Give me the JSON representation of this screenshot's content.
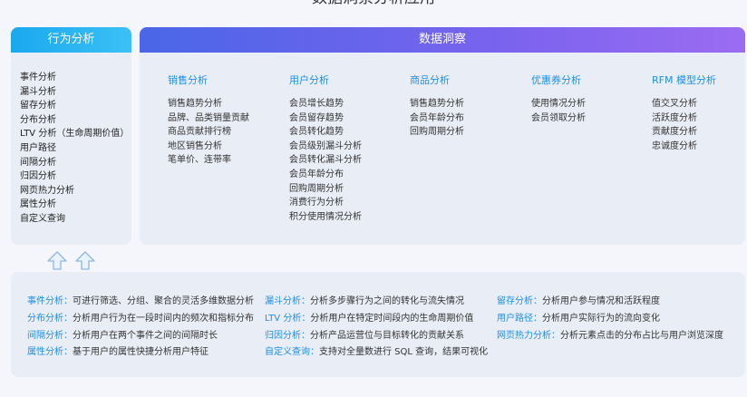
{
  "title": "数据洞察分析应用",
  "left_panel": {
    "header": "行为分析",
    "items": [
      "事件分析",
      "漏斗分析",
      "留存分析",
      "分布分析",
      "LTV 分析（生命周期价值）",
      "用户路径",
      "间隔分析",
      "归因分析",
      "网页热力分析",
      "属性分析",
      "自定义查询"
    ]
  },
  "right_panel": {
    "header": "数据洞察",
    "columns": [
      {
        "title": "销售分析",
        "items": [
          "销售趋势分析",
          "品牌、品类销量贡献",
          "商品贡献排行榜",
          "地区销售分析",
          "笔单价、连带率"
        ]
      },
      {
        "title": "用户分析",
        "items": [
          "会员增长趋势",
          "会员留存趋势",
          "会员转化趋势",
          "会员级别漏斗分析",
          "会员转化漏斗分析",
          "会员年龄分布",
          "回购周期分析",
          "消费行为分析",
          "积分使用情况分析"
        ]
      },
      {
        "title": "商品分析",
        "items": [
          "销售趋势分析",
          "会员年龄分布",
          "回购周期分析"
        ]
      },
      {
        "title": "优惠券分析",
        "items": [
          "使用情况分析",
          "会员领取分析"
        ]
      },
      {
        "title": "RFM 模型分析",
        "items": [
          "值交叉分析",
          "活跃度分析",
          "贡献度分析",
          "忠诚度分析"
        ]
      }
    ]
  },
  "descriptions": [
    {
      "key": "事件分析：",
      "value": "可进行筛选、分组、聚合的灵活多维数据分析"
    },
    {
      "key": "漏斗分析：",
      "value": "分析多步骤行为之间的转化与流失情况"
    },
    {
      "key": "留存分析：",
      "value": "分析用户参与情况和活跃程度"
    },
    {
      "key": "分布分析：",
      "value": "分析用户行为在一段时间内的频次和指标分布"
    },
    {
      "key": "LTV 分析：",
      "value": "分析用户在特定时间段内的生命周期价值"
    },
    {
      "key": "用户路径：",
      "value": "分析用户实际行为的流向变化"
    },
    {
      "key": "间隔分析：",
      "value": "分析用户在两个事件之间的间隔时长"
    },
    {
      "key": "归因分析：",
      "value": "分析产品运营位与目标转化的贡献关系"
    },
    {
      "key": "网页热力分析：",
      "value": "分析元素点击的分布占比与用户浏览深度"
    },
    {
      "key": "属性分析：",
      "value": "基于用户的属性快捷分析用户特征"
    },
    {
      "key": "自定义查询：",
      "value": "支持对全量数进行 SQL 查询，结果可视化"
    }
  ],
  "colors": {
    "left_header": "#1aa9ee",
    "right_header": "#6a64ec",
    "key_text": "#1f8fe5"
  },
  "icons": [
    "up-arrow-icon",
    "up-arrow-icon"
  ]
}
